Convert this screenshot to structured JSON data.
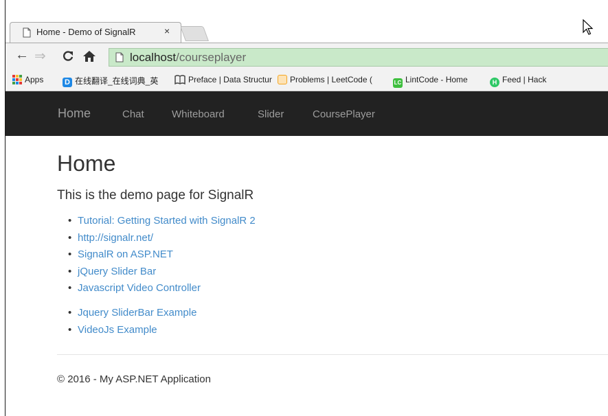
{
  "browser": {
    "tab_title": "Home - Demo of SignalR",
    "tab_close": "×",
    "url_host": "localhost",
    "url_path": "/courseplayer",
    "bookmarks": [
      {
        "label": "Apps",
        "icon": "apps-grid-icon",
        "color": "#e53935"
      },
      {
        "label": "在线翻译_在线词典_英",
        "icon": "dict-d-icon",
        "color": "#1e88e5"
      },
      {
        "label": "Preface | Data Structur",
        "icon": "book-icon",
        "color": "#555555"
      },
      {
        "label": "Problems | LeetCode (",
        "icon": "leetcode-icon",
        "color": "#f4a623"
      },
      {
        "label": "LintCode - Home",
        "icon": "lintcode-icon",
        "color": "#3fbf3f"
      },
      {
        "label": "Feed | Hack",
        "icon": "hackerrank-icon",
        "color": "#2ec866"
      }
    ]
  },
  "navbar": {
    "brand": "Home",
    "links": [
      "Chat",
      "Whiteboard",
      "Slider",
      "CoursePlayer"
    ]
  },
  "main": {
    "title": "Home",
    "lead": "This is the demo page for SignalR",
    "links_group1": [
      "Tutorial: Getting Started with SignalR 2",
      "http://signalr.net/",
      "SignalR on ASP.NET",
      "jQuery Slider Bar",
      "Javascript Video Controller"
    ],
    "links_group2": [
      "Jquery SliderBar Example",
      "VideoJs Example"
    ]
  },
  "footer": {
    "text": "© 2016 - My ASP.NET Application"
  }
}
